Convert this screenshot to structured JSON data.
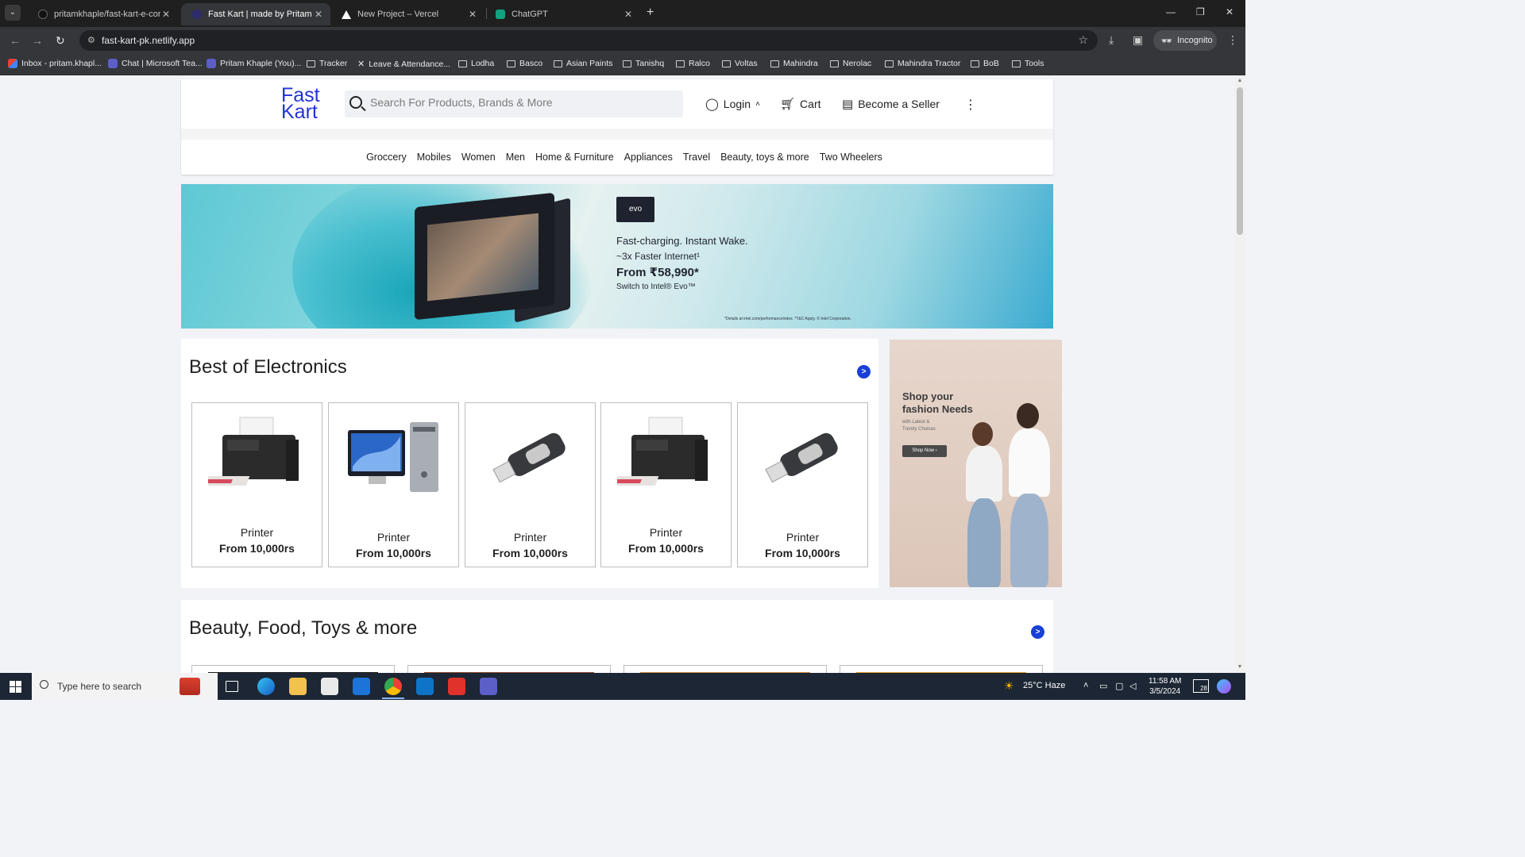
{
  "browser": {
    "tabs": [
      {
        "title": "pritamkhaple/fast-kart-e-comm",
        "active": false,
        "favicon": "github-icon"
      },
      {
        "title": "Fast Kart | made by Pritam",
        "active": true,
        "favicon": "fastkart-icon"
      },
      {
        "title": "New Project – Vercel",
        "active": false,
        "favicon": "vercel-icon"
      },
      {
        "title": "ChatGPT",
        "active": false,
        "favicon": "chatgpt-icon"
      }
    ],
    "url": "fast-kart-pk.netlify.app",
    "incognito_label": "Incognito",
    "bookmarks": [
      {
        "label": "Inbox - pritam.khapl...",
        "icon": "gmail-icon"
      },
      {
        "label": "Chat | Microsoft Tea...",
        "icon": "teams-icon"
      },
      {
        "label": "Pritam Khaple (You)...",
        "icon": "teams-icon"
      },
      {
        "label": "Tracker",
        "icon": "folder-icon"
      },
      {
        "label": "Leave & Attendance...",
        "icon": "x-icon"
      },
      {
        "label": "Lodha",
        "icon": "folder-icon"
      },
      {
        "label": "Basco",
        "icon": "folder-icon"
      },
      {
        "label": "Asian Paints",
        "icon": "folder-icon"
      },
      {
        "label": "Tanishq",
        "icon": "folder-icon"
      },
      {
        "label": "Ralco",
        "icon": "folder-icon"
      },
      {
        "label": "Voltas",
        "icon": "folder-icon"
      },
      {
        "label": "Mahindra",
        "icon": "folder-icon"
      },
      {
        "label": "Nerolac",
        "icon": "folder-icon"
      },
      {
        "label": "Mahindra Tractor",
        "icon": "folder-icon"
      },
      {
        "label": "BoB",
        "icon": "folder-icon"
      },
      {
        "label": "Tools",
        "icon": "folder-icon"
      }
    ]
  },
  "header": {
    "logo_line1": "Fast",
    "logo_line2": "Kart",
    "search_placeholder": "Search For Products, Brands & More",
    "login_label": "Login",
    "login_caret": "˄",
    "cart_label": "Cart",
    "seller_label": "Become a Seller",
    "more_icon": "⋮",
    "categories": [
      "Groccery",
      "Mobiles",
      "Women",
      "Men",
      "Home & Furniture",
      "Appliances",
      "Travel",
      "Beauty, toys & more",
      "Two Wheelers"
    ]
  },
  "banner": {
    "badge": "evo",
    "line1": "Fast-charging. Instant Wake.",
    "line2": "~3x Faster Internet¹",
    "line3": "From ₹58,990*",
    "line4": "Switch to Intel® Evo™",
    "fine_print": "*Details at intel.com/performanceindex. *T&C Apply. © Intel Corporation."
  },
  "electronics": {
    "title": "Best of Electronics",
    "arrow": ">",
    "products": [
      {
        "name": "Printer",
        "price": "From 10,000rs",
        "image": "printer"
      },
      {
        "name": "Printer",
        "price": "From 10,000rs",
        "image": "desktop-computer"
      },
      {
        "name": "Printer",
        "price": "From 10,000rs",
        "image": "usb-drive"
      },
      {
        "name": "Printer",
        "price": "From 10,000rs",
        "image": "printer"
      },
      {
        "name": "Printer",
        "price": "From 10,000rs",
        "image": "usb-drive"
      }
    ]
  },
  "fashion_ad": {
    "headline_1": "Shop your",
    "headline_2": "fashion Needs",
    "sub_1": "with Latest &",
    "sub_2": "Trendy Choices",
    "button": "Shop Now ›"
  },
  "beauty": {
    "title": "Beauty, Food, Toys & more",
    "arrow": ">"
  },
  "taskbar": {
    "search_placeholder": "Type here to search",
    "weather": "25°C  Haze",
    "time": "11:58 AM",
    "date": "3/5/2024",
    "notifications": "28"
  },
  "colors": {
    "brand": "#2233d6",
    "arrow": "#1a3fd6",
    "chrome_dark": "#35363a"
  }
}
